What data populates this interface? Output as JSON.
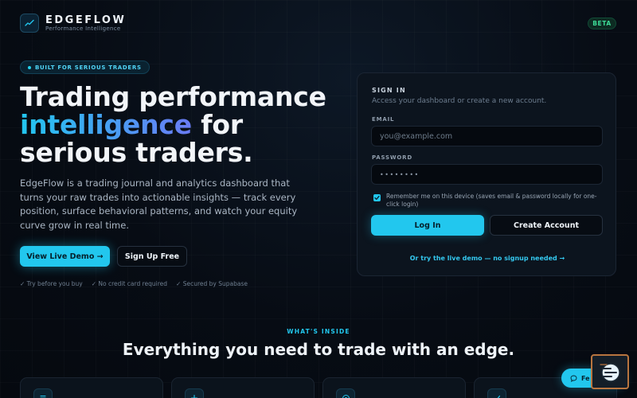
{
  "brand": {
    "name": "EDGEFLOW",
    "tagline": "Performance Intelligence",
    "badge": "BETA",
    "logo_icon": "chart-trend-icon"
  },
  "hero": {
    "pill": "BUILT FOR SERIOUS TRADERS",
    "title_line1": "Trading performance",
    "title_accent": "intelligence",
    "title_after_accent": " for",
    "title_line3": "serious traders.",
    "description": "EdgeFlow is a trading journal and analytics dashboard that turns your raw trades into actionable insights — track every position, surface behavioral patterns, and watch your equity curve grow in real time.",
    "primary_cta": "View Live Demo →",
    "secondary_cta": "Sign Up Free",
    "trust_items": [
      "✓ Try before you buy",
      "✓ No credit card required",
      "✓ Secured by Supabase"
    ]
  },
  "signin": {
    "title": "SIGN IN",
    "subtitle": "Access your dashboard or create a new account.",
    "email_label": "EMAIL",
    "email_placeholder": "you@example.com",
    "password_label": "PASSWORD",
    "password_value": "••••••••",
    "remember_checked": true,
    "remember_label": "Remember me on this device (saves email & password locally for one-click login)",
    "login_button": "Log In",
    "create_button": "Create Account",
    "demo_link": "Or try the live demo — no signup needed →"
  },
  "features": {
    "eyebrow": "WHAT'S INSIDE",
    "title": "Everything you need to trade with an edge.",
    "card_icons": [
      "journal-icon",
      "plus-chart-icon",
      "target-icon",
      "check-icon"
    ]
  },
  "feedback": {
    "label": "Fe",
    "icon": "chat-bubble-icon"
  },
  "colors": {
    "accent": "#22c7ee",
    "background": "#060b12",
    "success": "#3ddc97"
  }
}
